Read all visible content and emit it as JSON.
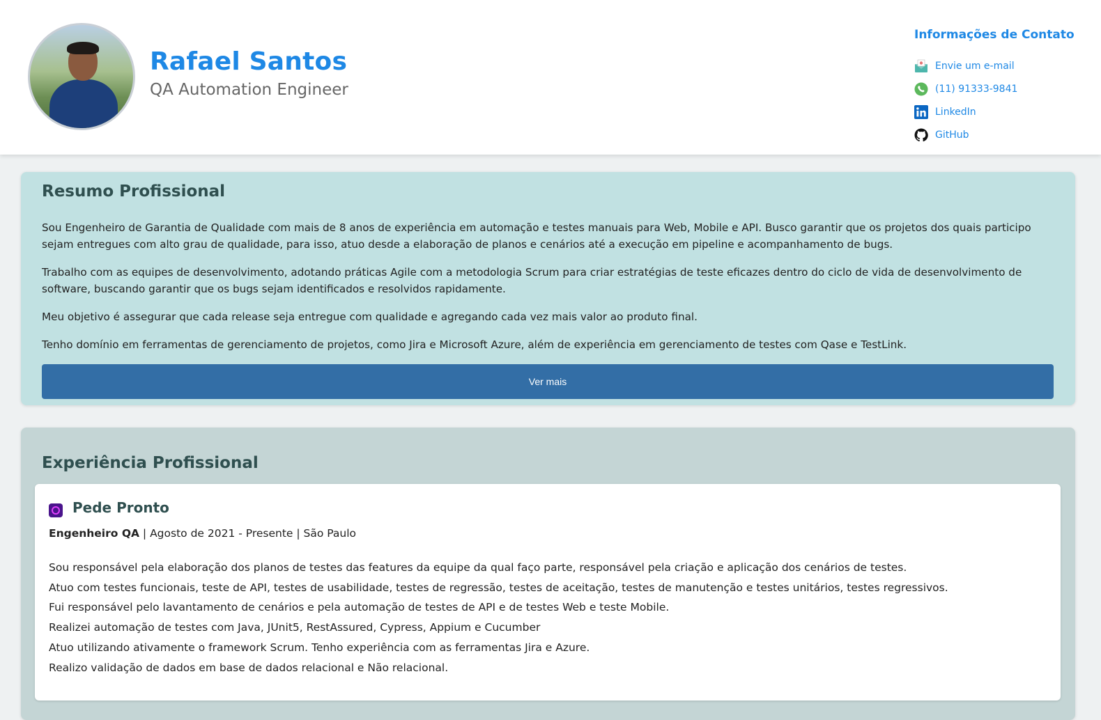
{
  "header": {
    "name": "Rafael Santos",
    "role": "QA Automation Engineer",
    "avatar_alt": "profile photo"
  },
  "contact": {
    "title": "Informações de Contato",
    "items": [
      {
        "label": "Envie um e-mail",
        "icon": "mail-icon"
      },
      {
        "label": "(11) 91333-9841",
        "icon": "whatsapp-icon"
      },
      {
        "label": "LinkedIn",
        "icon": "linkedin-icon"
      },
      {
        "label": "GitHub",
        "icon": "github-icon"
      }
    ]
  },
  "summary": {
    "title": "Resumo Profissional",
    "paragraphs": [
      "Sou Engenheiro de Garantia de Qualidade com mais de 8 anos de experiência em automação e testes manuais para Web, Mobile e API. Busco garantir que os projetos dos quais participo sejam entregues com alto grau de qualidade, para isso, atuo desde a elaboração de planos e cenários até a execução em pipeline e acompanhamento de bugs.",
      "Trabalho com as equipes de desenvolvimento, adotando práticas Agile com a metodologia Scrum para criar estratégias de teste eficazes dentro do ciclo de vida de desenvolvimento de software, buscando garantir que os bugs sejam identificados e resolvidos rapidamente.",
      "Meu objetivo é assegurar que cada release seja entregue com qualidade e agregando cada vez mais valor ao produto final.",
      "Tenho domínio em ferramentas de gerenciamento de projetos, como Jira e Microsoft Azure, além de experiência em gerenciamento de testes com Qase e TestLink."
    ],
    "button_label": "Ver mais"
  },
  "experience": {
    "title": "Experiência Profissional",
    "jobs": [
      {
        "company": "Pede Pronto",
        "position": "Engenheiro QA",
        "details": " | Agosto de 2021 - Presente | São Paulo",
        "items": [
          "Sou responsável pela elaboração dos planos de testes das features da equipe da qual faço parte, responsável pela criação e aplicação dos cenários de testes.",
          "Atuo com testes funcionais, teste de API, testes de usabilidade, testes de regressão, testes de aceitação, testes de manutenção e testes unitários, testes regressivos.",
          "Fui responsável pelo lavantamento de cenários e pela automação de testes de API e de testes Web e teste Mobile.",
          "Realizei automação de testes com Java, JUnit5, RestAssured, Cypress, Appium e Cucumber",
          "Atuo utilizando ativamente o framework Scrum. Tenho experiência com as ferramentas Jira e Azure.",
          "Realizo validação de dados em base de dados relacional e Não relacional."
        ]
      }
    ]
  },
  "colors": {
    "accent": "#1e88e5",
    "summary_bg": "#c1e1e2",
    "experience_bg": "#c4d5d5",
    "button_bg": "#336ea6"
  }
}
